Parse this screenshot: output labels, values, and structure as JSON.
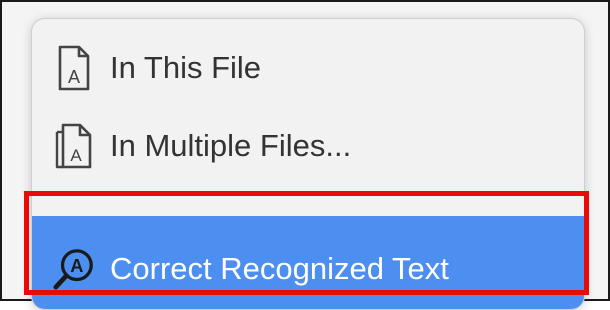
{
  "menu": {
    "items": [
      {
        "label": "In This File",
        "icon": "document-a-icon"
      },
      {
        "label": "In Multiple Files...",
        "icon": "multiple-documents-a-icon"
      },
      {
        "label": "Correct Recognized Text",
        "icon": "magnifier-a-icon",
        "highlighted": true
      }
    ],
    "icon_glyph": "A"
  },
  "colors": {
    "selection": "#4c8ff0",
    "annotation": "#ea0a0a",
    "text": "#333333"
  }
}
